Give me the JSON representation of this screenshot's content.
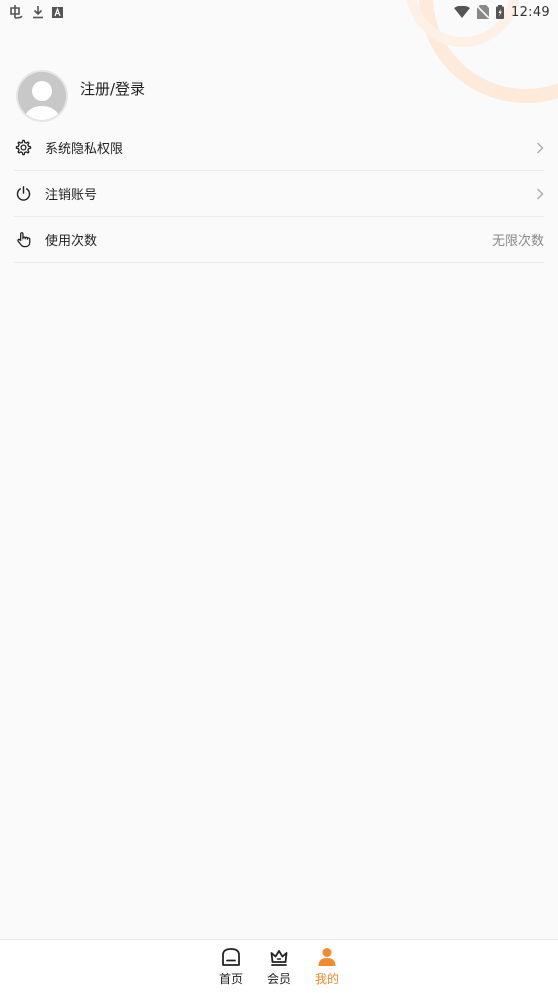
{
  "status_bar": {
    "time": "12:49",
    "left_icons": [
      "app-notification-icon",
      "download-icon",
      "a-box-icon"
    ],
    "right_icons": [
      "wifi-icon",
      "no-sim-icon",
      "battery-charging-icon"
    ]
  },
  "profile": {
    "login_label": "注册/登录"
  },
  "menu": {
    "items": [
      {
        "label": "系统隐私权限",
        "icon": "gear-icon",
        "value": "",
        "has_chevron": true
      },
      {
        "label": "注销账号",
        "icon": "power-icon",
        "value": "",
        "has_chevron": true
      },
      {
        "label": "使用次数",
        "icon": "hand-pointer-icon",
        "value": "无限次数",
        "has_chevron": false
      }
    ]
  },
  "bottom_nav": {
    "items": [
      {
        "label": "首页",
        "icon": "home-icon",
        "active": false
      },
      {
        "label": "会员",
        "icon": "crown-icon",
        "active": false
      },
      {
        "label": "我的",
        "icon": "user-icon",
        "active": true
      }
    ]
  },
  "colors": {
    "accent": "#f28a2e",
    "background": "#fafafa",
    "divider": "#ececec",
    "deco_ring": "#fde7d6"
  }
}
